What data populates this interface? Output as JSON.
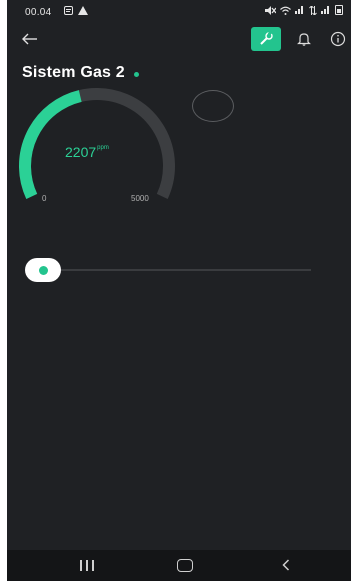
{
  "status_bar": {
    "time": "00.04",
    "left_icons": [
      "notification-icon",
      "warning-icon"
    ],
    "right_icons": [
      "mute-icon",
      "wifi-icon",
      "signal-icon",
      "data-icon",
      "signal-icon",
      "battery-icon"
    ]
  },
  "header": {
    "back_icon": "arrow-left-icon",
    "actions": [
      "wrench-icon",
      "bell-icon",
      "info-icon"
    ],
    "accent_color": "#23c48e"
  },
  "device": {
    "title": "Sistem Gas 2",
    "online": true
  },
  "gauge": {
    "value": "2207",
    "unit": "ppm",
    "min": "0",
    "max": "5000",
    "fraction": 0.4414,
    "color": "#2bd196"
  },
  "led": {
    "state": "off"
  },
  "slider": {
    "fraction": 0
  },
  "nav_bar": {
    "icons": [
      "recents-icon",
      "home-icon",
      "back-icon"
    ]
  }
}
